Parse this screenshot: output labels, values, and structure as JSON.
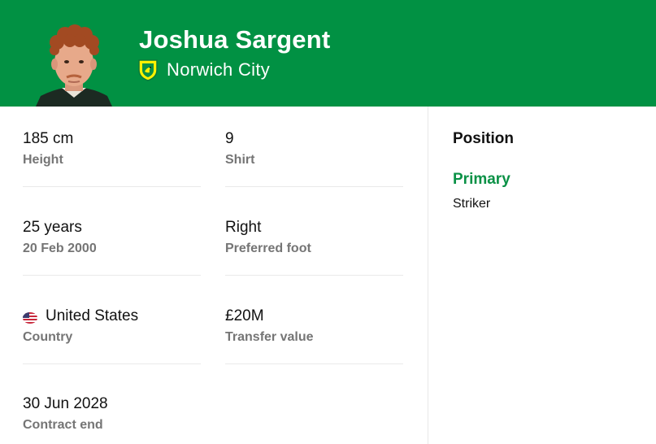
{
  "header": {
    "player_name": "Joshua Sargent",
    "team_name": "Norwich City",
    "background_color": "#019143"
  },
  "stats": {
    "height": {
      "value": "185 cm",
      "label": "Height"
    },
    "shirt": {
      "value": "9",
      "label": "Shirt"
    },
    "age": {
      "value": "25 years",
      "label": "20 Feb 2000"
    },
    "foot": {
      "value": "Right",
      "label": "Preferred foot"
    },
    "country": {
      "value": "United States",
      "label": "Country",
      "flag_icon": "us-flag-icon"
    },
    "transfer": {
      "value": "£20M",
      "label": "Transfer value"
    },
    "contract": {
      "value": "30 Jun 2028",
      "label": "Contract end"
    }
  },
  "position": {
    "title": "Position",
    "primary_label": "Primary",
    "primary_role": "Striker",
    "accent_color": "#0a9146"
  }
}
